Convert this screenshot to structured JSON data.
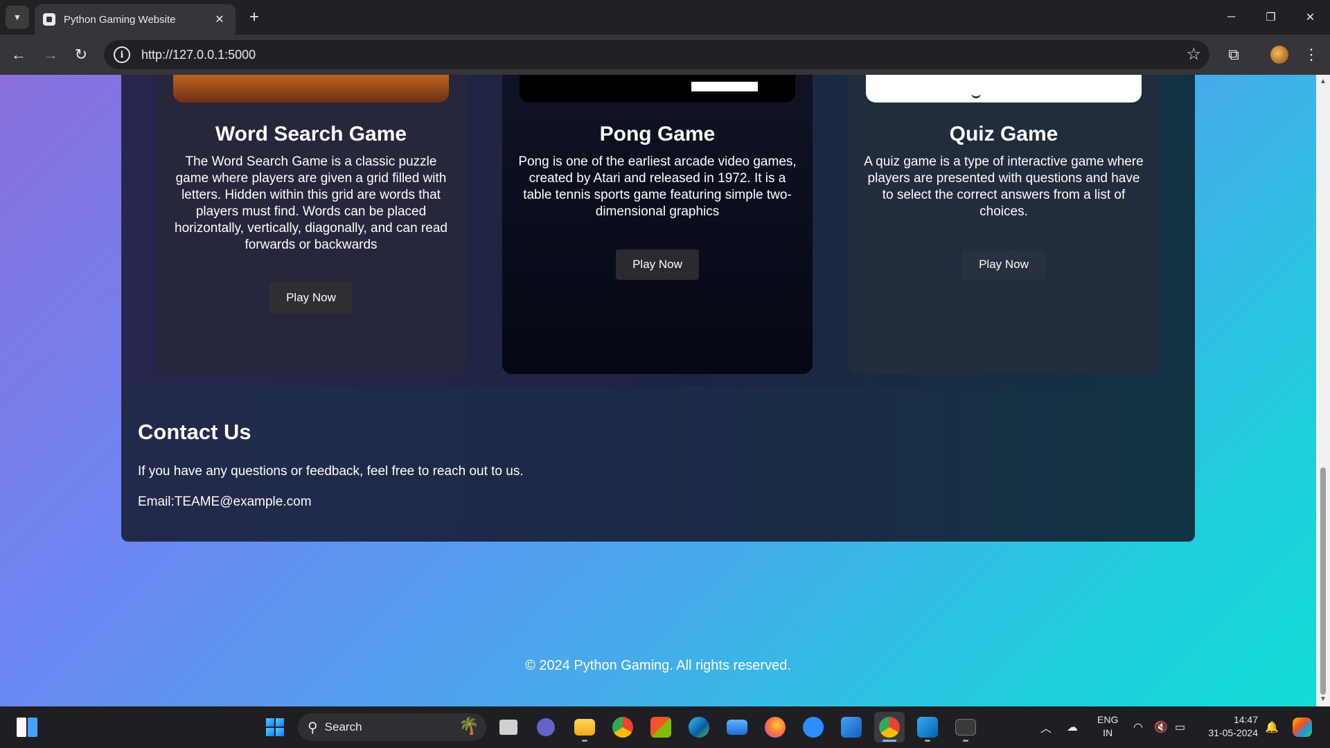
{
  "browser": {
    "tab_title": "Python Gaming Website",
    "url": "http://127.0.0.1:5000"
  },
  "games": [
    {
      "title": "Word Search Game",
      "description": "The Word Search Game is a classic puzzle game where players are given a grid filled with letters. Hidden within this grid are words that players must find. Words can be placed horizontally, vertically, diagonally, and can read forwards or backwards",
      "button": "Play Now"
    },
    {
      "title": "Pong Game",
      "description": "Pong is one of the earliest arcade video games, created by Atari and released in 1972. It is a table tennis sports game featuring simple two-dimensional graphics",
      "button": "Play Now"
    },
    {
      "title": "Quiz Game",
      "description": "A quiz game is a type of interactive game where players are presented with questions and have to select the correct answers from a list of choices.",
      "button": "Play Now"
    }
  ],
  "contact": {
    "title": "Contact Us",
    "text": "If you have any questions or feedback, feel free to reach out to us.",
    "email": "Email:TEAME@example.com"
  },
  "footer": {
    "text": "© 2024 Python Gaming. All rights reserved."
  },
  "taskbar": {
    "search_label": "Search",
    "lang_line1": "ENG",
    "lang_line2": "IN",
    "time": "14:47",
    "date": "31-05-2024",
    "apps": [
      "file-explorer",
      "teams",
      "folder",
      "chrome",
      "store",
      "edge",
      "mail",
      "firefox",
      "zoom",
      "word",
      "chrome-active",
      "vscode",
      "terminal"
    ]
  },
  "colors": {
    "page_gradient_start": "#8a70dc",
    "page_gradient_end": "#12dcd4",
    "section_bg": "#1d2440",
    "button_bg": "#2f2f33"
  }
}
